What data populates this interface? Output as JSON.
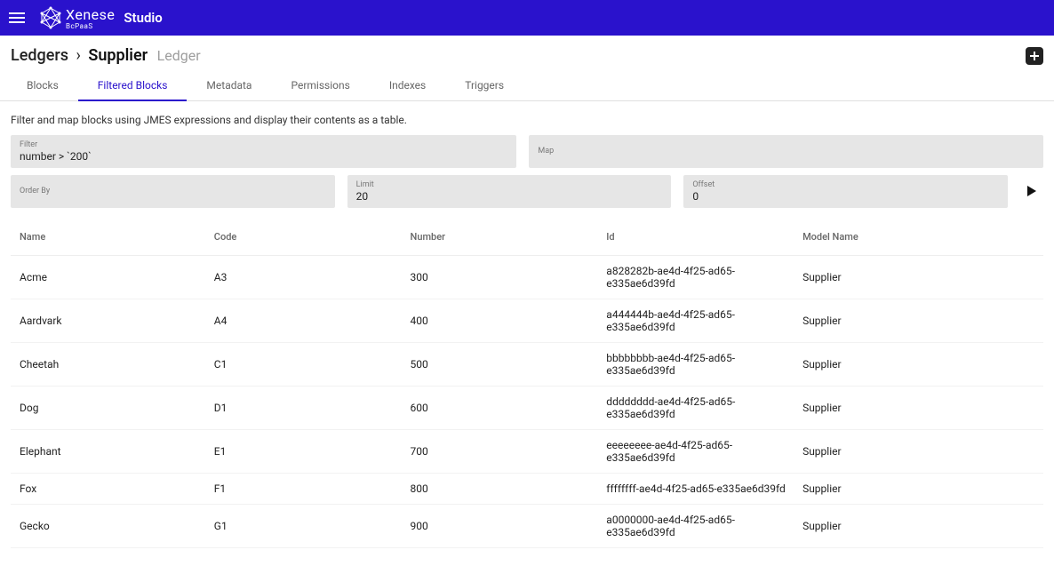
{
  "app": {
    "brand_main": "Xenese",
    "brand_sub": "BcPaaS",
    "studio_label": "Studio"
  },
  "breadcrumb": {
    "section": "Ledgers",
    "current": "Supplier",
    "type_label": "Ledger"
  },
  "tabs": [
    {
      "label": "Blocks",
      "active": false
    },
    {
      "label": "Filtered Blocks",
      "active": true
    },
    {
      "label": "Metadata",
      "active": false
    },
    {
      "label": "Permissions",
      "active": false
    },
    {
      "label": "Indexes",
      "active": false
    },
    {
      "label": "Triggers",
      "active": false
    }
  ],
  "description": "Filter and map blocks using JMES expressions and display their contents as a table.",
  "fields": {
    "filter": {
      "label": "Filter",
      "value": "number > `200`"
    },
    "map": {
      "label": "Map",
      "value": ""
    },
    "orderby": {
      "label": "Order By",
      "value": ""
    },
    "limit": {
      "label": "Limit",
      "value": "20"
    },
    "offset": {
      "label": "Offset",
      "value": "0"
    }
  },
  "table": {
    "headers": {
      "name": "Name",
      "code": "Code",
      "number": "Number",
      "id": "Id",
      "model": "Model Name"
    },
    "rows": [
      {
        "name": "Acme",
        "code": "A3",
        "number": "300",
        "id": "a828282b-ae4d-4f25-ad65-e335ae6d39fd",
        "model": "Supplier"
      },
      {
        "name": "Aardvark",
        "code": "A4",
        "number": "400",
        "id": "a444444b-ae4d-4f25-ad65-e335ae6d39fd",
        "model": "Supplier"
      },
      {
        "name": "Cheetah",
        "code": "C1",
        "number": "500",
        "id": "bbbbbbbb-ae4d-4f25-ad65-e335ae6d39fd",
        "model": "Supplier"
      },
      {
        "name": "Dog",
        "code": "D1",
        "number": "600",
        "id": "dddddddd-ae4d-4f25-ad65-e335ae6d39fd",
        "model": "Supplier"
      },
      {
        "name": "Elephant",
        "code": "E1",
        "number": "700",
        "id": "eeeeeeee-ae4d-4f25-ad65-e335ae6d39fd",
        "model": "Supplier"
      },
      {
        "name": "Fox",
        "code": "F1",
        "number": "800",
        "id": "ffffffff-ae4d-4f25-ad65-e335ae6d39fd",
        "model": "Supplier"
      },
      {
        "name": "Gecko",
        "code": "G1",
        "number": "900",
        "id": "a0000000-ae4d-4f25-ad65-e335ae6d39fd",
        "model": "Supplier"
      }
    ]
  }
}
